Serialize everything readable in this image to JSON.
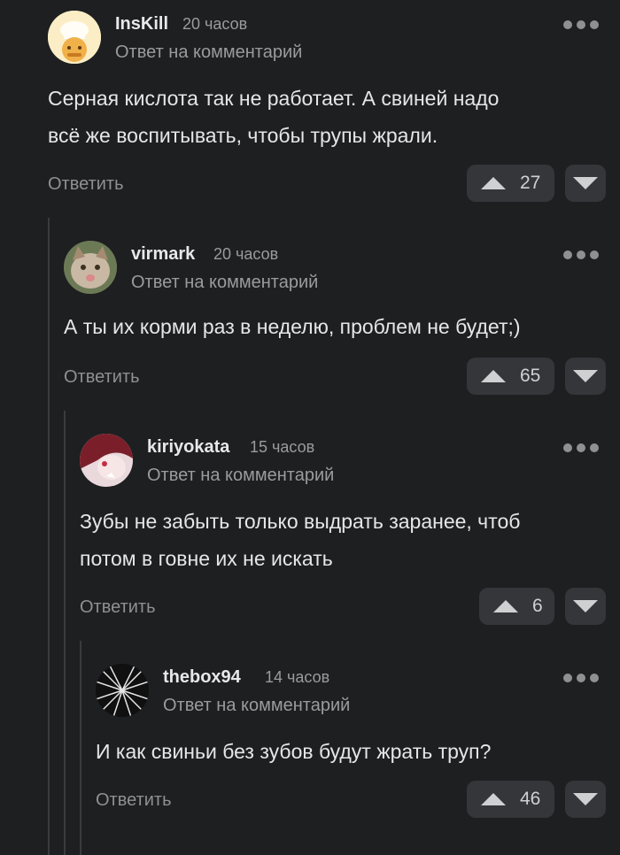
{
  "comments": [
    {
      "username": "InsKill",
      "time": "20 часов",
      "reply_to": "Ответ на комментарий",
      "text_lines": [
        "Серная кислота так не работает. А свиней надо",
        "всё же воспитывать, чтобы трупы жрали."
      ],
      "reply_label": "Ответить",
      "votes": "27",
      "avatar": "avatar-cook"
    },
    {
      "username": "virmark",
      "time": "20 часов",
      "reply_to": "Ответ на комментарий",
      "text_lines": [
        "А ты их корми раз в неделю, проблем не будет;)"
      ],
      "reply_label": "Ответить",
      "votes": "65",
      "avatar": "avatar-cat"
    },
    {
      "username": "kiriyokata",
      "time": "15 часов",
      "reply_to": "Ответ на комментарий",
      "text_lines": [
        "Зубы не забыть только выдрать заранее, чтоб",
        "потом в говне их не искать"
      ],
      "reply_label": "Ответить",
      "votes": "6",
      "avatar": "avatar-anime"
    },
    {
      "username": "thebox94",
      "time": "14 часов",
      "reply_to": "Ответ на комментарий",
      "text_lines": [
        "И как свиньи без зубов будут жрать труп?"
      ],
      "reply_label": "Ответить",
      "votes": "46",
      "avatar": "avatar-rays"
    }
  ],
  "colors": {
    "background": "#1e1f21",
    "button": "#34363a",
    "muted": "#9a9b9e"
  }
}
